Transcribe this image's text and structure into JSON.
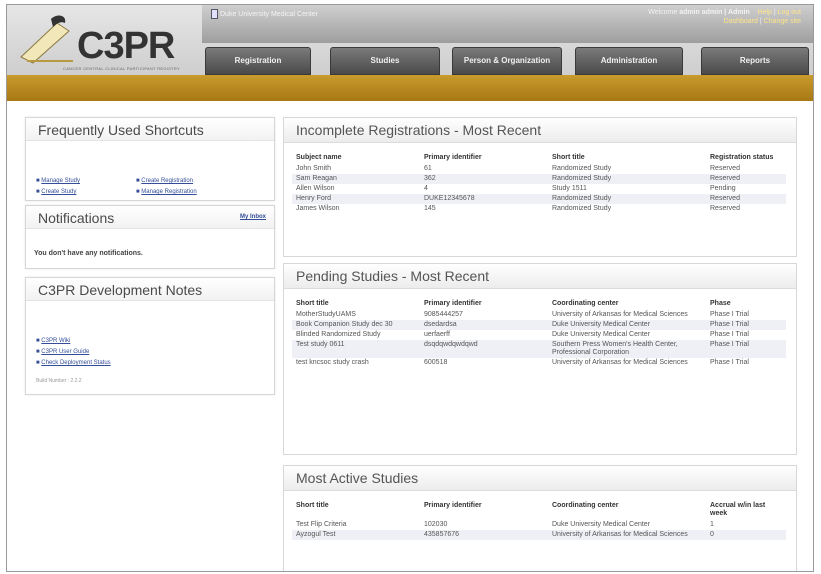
{
  "header": {
    "logo_text": "C3PR",
    "logo_tagline": "CANCER CENTRAL CLINICAL PARTICIPANT REGISTRY",
    "site_link": "Duke University Medical Center",
    "welcome_prefix": "Welcome",
    "welcome_user": "admin admin | Admin",
    "help_link": "Help",
    "logout_link": "Log out",
    "dashboard_link": "Dashboard",
    "change_site_link": "Change site",
    "tabs": [
      "Registration",
      "Studies",
      "Person & Organization",
      "Administration",
      "Reports"
    ]
  },
  "shortcuts": {
    "title": "Frequently Used Shortcuts",
    "col1": [
      "Manage Study",
      "Create Study"
    ],
    "col2": [
      "Create Registration",
      "Manage Registration"
    ]
  },
  "notifications": {
    "title": "Notifications",
    "inbox_link": "My Inbox",
    "message": "You don't have any notifications."
  },
  "dev_notes": {
    "title": "C3PR Development Notes",
    "links": [
      "C3PR Wiki",
      "C3PR User Guide",
      "Check Deployment Status"
    ],
    "build": "Build Number : 2.2.2"
  },
  "incomplete_registrations": {
    "title": "Incomplete Registrations - Most Recent",
    "headers": [
      "Subject name",
      "Primary identifier",
      "Short title",
      "Registration status"
    ],
    "rows": [
      [
        "John Smith",
        "61",
        "Randomized Study",
        "Reserved"
      ],
      [
        "Sam Reagan",
        "362",
        "Randomized Study",
        "Reserved"
      ],
      [
        "Allen Wilson",
        "4",
        "Study 1511",
        "Pending"
      ],
      [
        "Henry Ford",
        "DUKE12345678",
        "Randomized Study",
        "Reserved"
      ],
      [
        "James Wilson",
        "145",
        "Randomized Study",
        "Reserved"
      ]
    ]
  },
  "pending_studies": {
    "title": "Pending Studies - Most Recent",
    "headers": [
      "Short title",
      "Primary identifier",
      "Coordinating center",
      "Phase"
    ],
    "rows": [
      [
        "MotherStudyUAMS",
        "9085444257",
        "University of Arkansas for Medical Sciences",
        "Phase I Trial"
      ],
      [
        "Book Companion Study dec 30",
        "dsedardsa",
        "Duke University Medical Center",
        "Phase I Trial"
      ],
      [
        "Blinded Randomized Study",
        "uerfaerff",
        "Duke University Medical Center",
        "Phase I Trial"
      ],
      [
        "Test study 0611",
        "dsqdqwdqwdqwd",
        "Southern Press Women's Health Center, Professional Corporation",
        "Phase I Trial"
      ],
      [
        "test kncsoc study crash",
        "600518",
        "University of Arkansas for Medical Sciences",
        "Phase I Trial"
      ]
    ]
  },
  "most_active": {
    "title": "Most Active Studies",
    "headers": [
      "Short title",
      "Primary identifier",
      "Coordinating center",
      "Accrual w/in last week"
    ],
    "rows": [
      [
        "Test Flip Criteria",
        "102030",
        "Duke University Medical Center",
        "1"
      ],
      [
        "Ayzogul Test",
        "435857676",
        "University of Arkansas for Medical Sciences",
        "0"
      ]
    ]
  },
  "colors": {
    "gold_bar": "#b8861e",
    "nav_tab": "#5a5a5a",
    "link": "#334d99",
    "alt_row": "#eef0f6"
  }
}
